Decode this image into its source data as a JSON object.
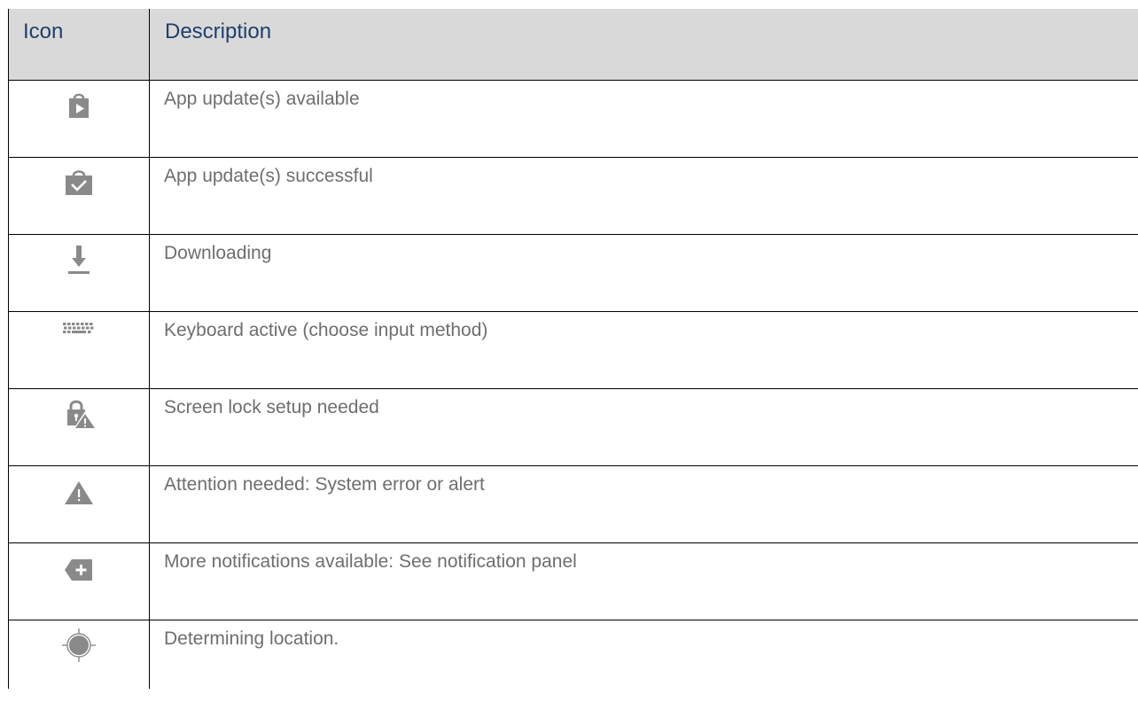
{
  "table": {
    "header": {
      "icon": "Icon",
      "description": "Description"
    },
    "rows": [
      {
        "icon": "app-update-available-icon",
        "description": "App update(s) available"
      },
      {
        "icon": "app-update-successful-icon",
        "description": "App update(s) successful"
      },
      {
        "icon": "downloading-icon",
        "description": "Downloading"
      },
      {
        "icon": "keyboard-icon",
        "description": "Keyboard active (choose input method)"
      },
      {
        "icon": "screen-lock-warning-icon",
        "description": "Screen lock setup needed"
      },
      {
        "icon": "alert-triangle-icon",
        "description": "Attention needed: System error or alert"
      },
      {
        "icon": "more-notifications-icon",
        "description": "More notifications available: See notification panel"
      },
      {
        "icon": "location-icon",
        "description": "Determining location."
      }
    ]
  },
  "colors": {
    "header_background": "#d9d9d9",
    "header_text": "#1f3f6c",
    "body_text": "#6e6e6e",
    "icon_gray": "#8a8a8a",
    "border": "#000000"
  }
}
